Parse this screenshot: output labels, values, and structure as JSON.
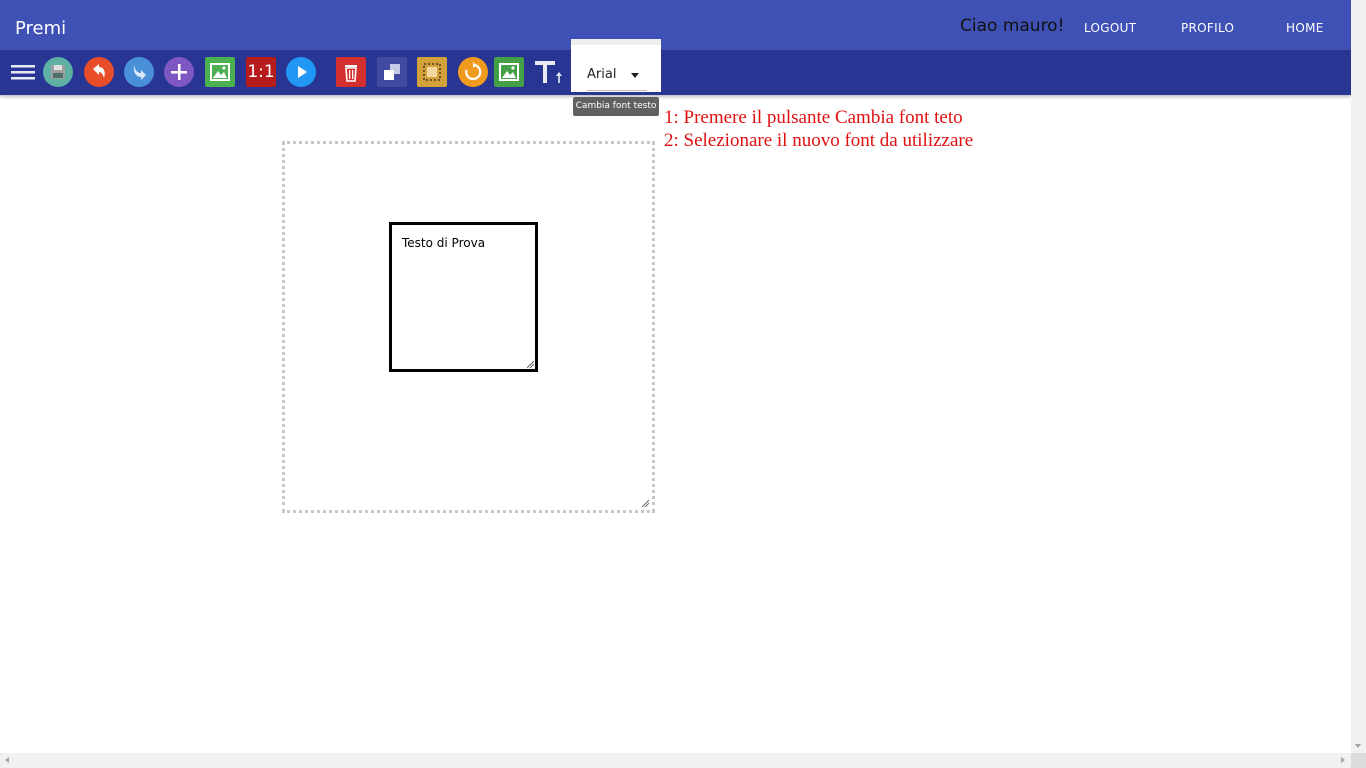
{
  "header": {
    "title": "Premi",
    "greeting": "Ciao mauro!",
    "nav": {
      "logout": "LOGOUT",
      "profilo": "PROFILO",
      "home": "HOME"
    }
  },
  "toolbar": {
    "buttons": [
      {
        "icon": "menu-icon"
      },
      {
        "icon": "save-icon",
        "color": "#5fb0a5"
      },
      {
        "icon": "undo-icon",
        "color": "#e84d2a"
      },
      {
        "icon": "redo-icon",
        "color": "#4a90d9"
      },
      {
        "icon": "add-icon",
        "color": "#7e57c2"
      },
      {
        "icon": "image-icon",
        "color": "#4caf50"
      },
      {
        "icon": "ratio-icon",
        "label": "1:1",
        "color": "#c62828"
      },
      {
        "icon": "play-icon",
        "color": "#2196f3"
      },
      {
        "icon": "delete-icon",
        "color": "#d32f2f"
      },
      {
        "icon": "layers-icon",
        "color": "#5c6bc0"
      },
      {
        "icon": "crop-icon",
        "color": "#d4a03a"
      },
      {
        "icon": "refresh-icon",
        "color": "#f09a1e"
      },
      {
        "icon": "image-icon",
        "color": "#43a047"
      },
      {
        "icon": "text-size-icon"
      }
    ],
    "font_select": {
      "value": "Arial"
    },
    "tooltip": "Cambia font testo"
  },
  "instructions": {
    "line1": "1: Premere il pulsante Cambia font teto",
    "line2": "2: Selezionare il nuovo font da utilizzare"
  },
  "canvas": {
    "textbox": {
      "text": "Testo di Prova"
    }
  }
}
